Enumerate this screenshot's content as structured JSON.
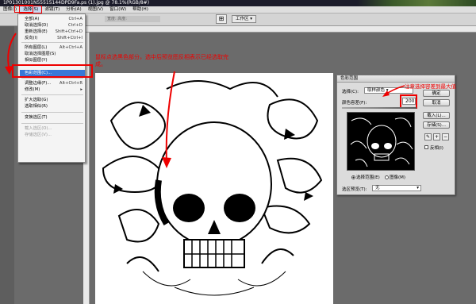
{
  "titlebar": {
    "text": "1P01301001N55515144DPD9Fa.ps (1).jpg @ 78.1%(RGB/8#)"
  },
  "menubar": {
    "items": [
      {
        "label": "图像(I)",
        "active": false
      },
      {
        "label": "选择(S)",
        "active": true
      },
      {
        "label": "滤镜(T)",
        "active": false
      },
      {
        "label": "分析(A)",
        "active": false
      },
      {
        "label": "视图(V)",
        "active": false
      },
      {
        "label": "窗口(W)",
        "active": false
      },
      {
        "label": "帮助(H)",
        "active": false
      }
    ]
  },
  "optionsbar": {
    "search_placeholder": "宽度: 高度:",
    "workspace_label": "工作区 ▾",
    "icon": "arrange-icon"
  },
  "select_menu": {
    "items": [
      {
        "label": "全部(A)",
        "shortcut": "Ctrl+A",
        "disabled": false
      },
      {
        "label": "取消选择(D)",
        "shortcut": "Ctrl+D",
        "disabled": false
      },
      {
        "label": "重新选择(E)",
        "shortcut": "Shift+Ctrl+D",
        "disabled": false
      },
      {
        "label": "反向(I)",
        "shortcut": "Shift+Ctrl+I",
        "disabled": false
      },
      {
        "label": "所有图层(L)",
        "shortcut": "Alt+Ctrl+A",
        "disabled": false
      },
      {
        "label": "取消选择图层(S)",
        "shortcut": "",
        "disabled": false
      },
      {
        "label": "相似图层(Y)",
        "shortcut": "",
        "disabled": false
      },
      {
        "label": "色彩范围(C)...",
        "shortcut": "",
        "disabled": false,
        "highlighted": true
      },
      {
        "label": "调整边缘(F)...",
        "shortcut": "Alt+Ctrl+R",
        "disabled": false
      },
      {
        "label": "修改(M)",
        "shortcut": "▸",
        "disabled": false
      },
      {
        "label": "扩大选取(G)",
        "shortcut": "",
        "disabled": false
      },
      {
        "label": "选取相似(R)",
        "shortcut": "",
        "disabled": false
      },
      {
        "label": "变换选区(T)",
        "shortcut": "",
        "disabled": false
      },
      {
        "label": "载入选区(O)...",
        "shortcut": "",
        "disabled": true
      },
      {
        "label": "存储选区(V)...",
        "shortcut": "",
        "disabled": true
      }
    ]
  },
  "annotations": {
    "left_note": "鼠标点选黑色部分，选中后预览图反相表示已经选取完成。",
    "right_note": "注意选择容差到最大值"
  },
  "color_range_dialog": {
    "title": "色彩范围",
    "select_label": "选择(C):",
    "select_value": "取样颜色",
    "fuzziness_label": "颜色容差(F):",
    "fuzziness_value": "200",
    "ok_label": "确定",
    "cancel_label": "取消",
    "load_label": "载入(L)...",
    "save_label": "存储(S)...",
    "radio_selection": "选择范围(E)",
    "radio_image": "图像(M)",
    "preview_label": "选区预览(T):",
    "preview_value": "无",
    "invert_label": "反相(I)"
  }
}
